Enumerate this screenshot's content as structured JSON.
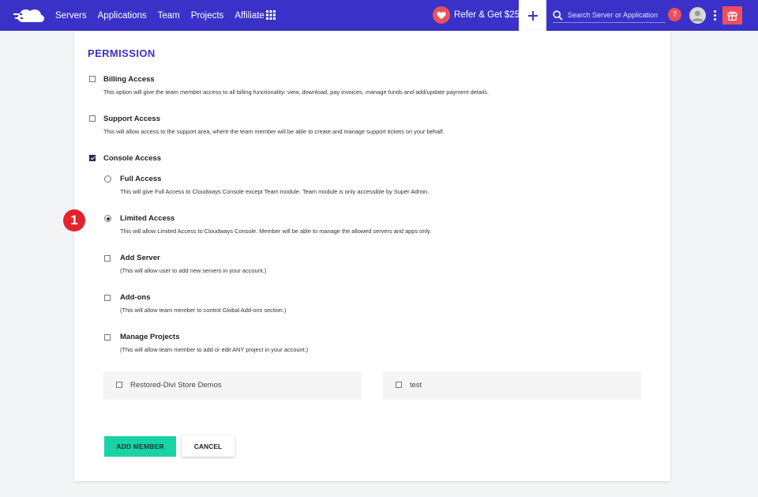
{
  "nav": {
    "items": [
      {
        "label": "Servers"
      },
      {
        "label": "Applications"
      },
      {
        "label": "Team"
      },
      {
        "label": "Projects"
      },
      {
        "label": "Affiliate"
      }
    ],
    "refer_label": "Refer & Get $25",
    "search_placeholder": "Search Server or Application",
    "notification_count": "7"
  },
  "permission": {
    "title": "PERMISSION",
    "billing": {
      "title": "Billing Access",
      "desc": "This option will give the team member access to all billing functionality: view, download, pay invoices, manage funds and add/update payment details.",
      "checked": false
    },
    "support": {
      "title": "Support Access",
      "desc": "This will allow access to the support area, where the team member will be able to create and manage support tickets on your behalf.",
      "checked": false
    },
    "console": {
      "title": "Console Access",
      "checked": true
    },
    "full": {
      "title": "Full Access",
      "desc": "This will give Full Access to Cloudways Console except Team module. Team module is only accessible by Super Admin.",
      "selected": false
    },
    "limited": {
      "title": "Limited Access",
      "desc": "This will allow Limited Access to Cloudways Console. Member will be able to manage the allowed servers and apps only.",
      "selected": true
    },
    "add_server": {
      "title": "Add Server",
      "desc": "(This will allow user to add new servers in your account.)",
      "checked": false
    },
    "addons": {
      "title": "Add-ons",
      "desc": "(This will allow team member to control Global Add-ons section.)",
      "checked": false
    },
    "manage_projects": {
      "title": "Manage Projects",
      "desc": "(This will allow team member to add or edit ANY project in your account.)",
      "checked": false
    },
    "projects": [
      {
        "label": "Restored-Divi Store Demos",
        "checked": false
      },
      {
        "label": "test",
        "checked": false
      }
    ]
  },
  "step_badge": "1",
  "actions": {
    "add_label": "ADD MEMBER",
    "cancel_label": "CANCEL"
  },
  "colors": {
    "topbar": "#3a32c8",
    "accent": "#19d3a4",
    "alert": "#ef4f5d",
    "badge": "#e2232b"
  }
}
